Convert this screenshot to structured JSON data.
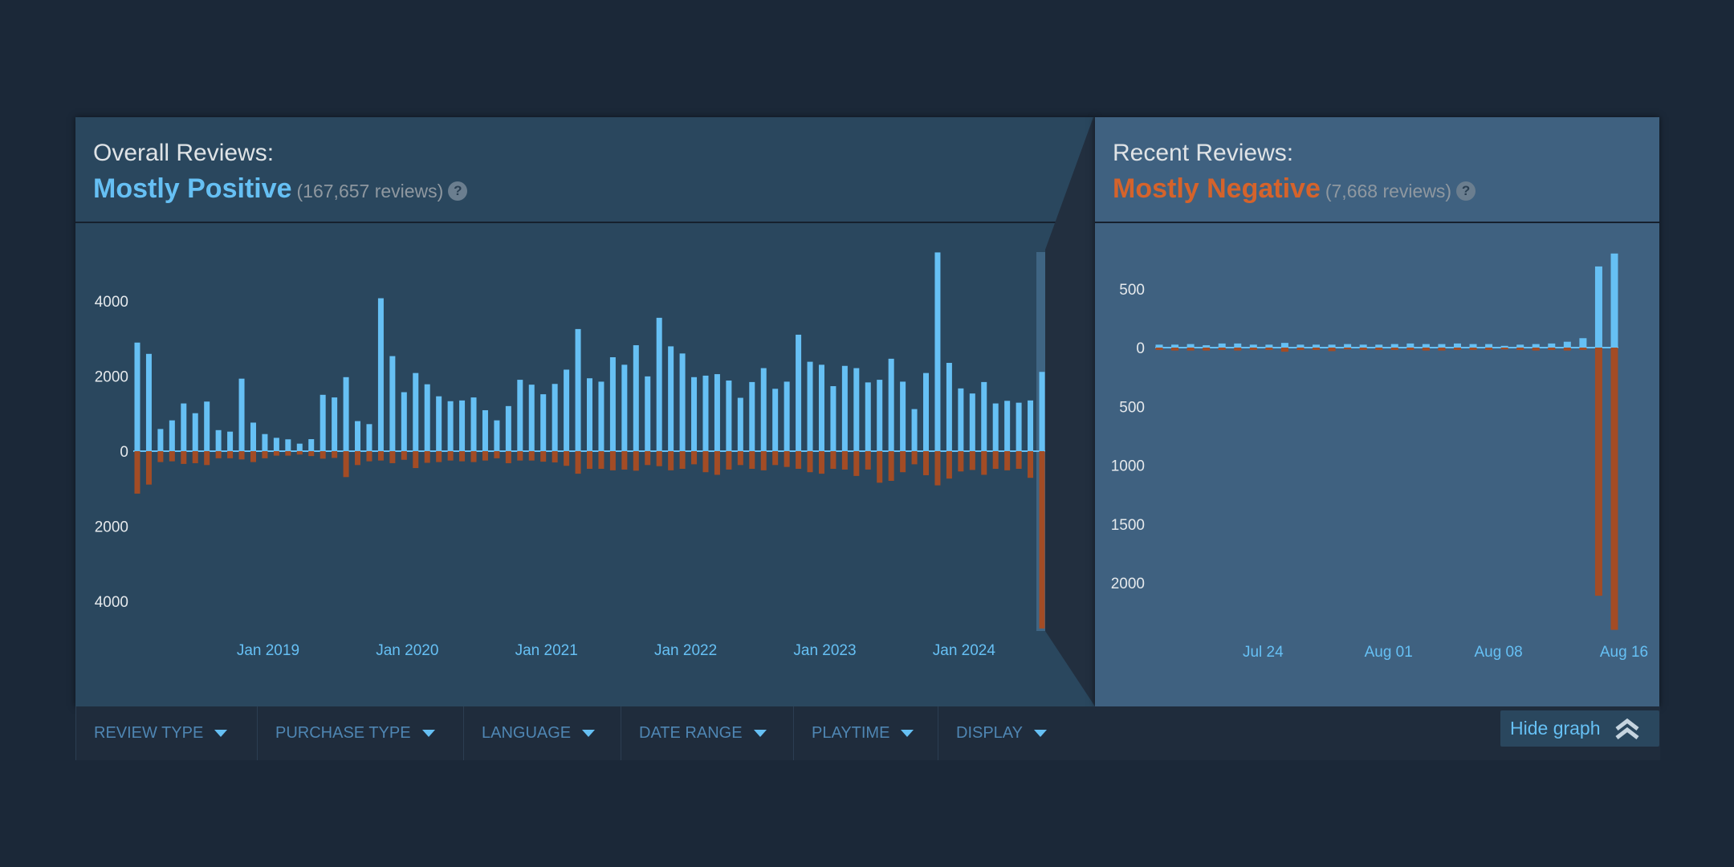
{
  "overall": {
    "title": "Overall Reviews:",
    "summary": "Mostly Positive",
    "count": "(167,657 reviews)",
    "help": "?",
    "color": "#66c0f4"
  },
  "recent": {
    "title": "Recent Reviews:",
    "summary": "Mostly Negative",
    "count": "(7,668 reviews)",
    "help": "?",
    "color": "#d5632b"
  },
  "filters": [
    {
      "label": "REVIEW TYPE"
    },
    {
      "label": "PURCHASE TYPE"
    },
    {
      "label": "LANGUAGE"
    },
    {
      "label": "DATE RANGE"
    },
    {
      "label": "PLAYTIME"
    },
    {
      "label": "DISPLAY"
    }
  ],
  "hide_graph": "Hide graph",
  "colors": {
    "positive": "#66c0f4",
    "negative": "#a34c25"
  },
  "chart_data": [
    {
      "type": "bar",
      "title": "",
      "xlabel": "",
      "ylabel": "",
      "period": "monthly, Feb 2018 - Aug 2024",
      "ylim": [
        -4800,
        5300
      ],
      "yticks": [
        {
          "v": 4000,
          "label": "4000"
        },
        {
          "v": 2000,
          "label": "2000"
        },
        {
          "v": 0,
          "label": "0"
        },
        {
          "v": -2000,
          "label": "2000"
        },
        {
          "v": -4000,
          "label": "4000"
        }
      ],
      "xticks": [
        {
          "i": 11,
          "label": "Jan 2019"
        },
        {
          "i": 23,
          "label": "Jan 2020"
        },
        {
          "i": 35,
          "label": "Jan 2021"
        },
        {
          "i": 47,
          "label": "Jan 2022"
        },
        {
          "i": 59,
          "label": "Jan 2023"
        },
        {
          "i": 71,
          "label": "Jan 2024"
        }
      ],
      "highlight_index": 78,
      "positive": [
        2890,
        2590,
        590,
        820,
        1270,
        1010,
        1320,
        560,
        520,
        1930,
        760,
        455,
        355,
        315,
        200,
        320,
        1500,
        1430,
        1970,
        800,
        720,
        4070,
        2530,
        1570,
        2080,
        1780,
        1460,
        1330,
        1350,
        1430,
        1090,
        820,
        1200,
        1900,
        1770,
        1515,
        1790,
        2170,
        3250,
        1940,
        1850,
        2500,
        2300,
        2820,
        1990,
        3550,
        2790,
        2600,
        1970,
        2010,
        2050,
        1880,
        1420,
        1840,
        2210,
        1660,
        1850,
        3100,
        2380,
        2300,
        1730,
        2270,
        2210,
        1830,
        1900,
        2460,
        1850,
        1120,
        2080,
        5290,
        2350,
        1670,
        1535,
        1840,
        1270,
        1340,
        1290,
        1350,
        2110
      ],
      "negative": [
        1130,
        890,
        290,
        270,
        340,
        320,
        370,
        190,
        190,
        220,
        290,
        190,
        120,
        120,
        90,
        130,
        200,
        180,
        690,
        370,
        270,
        250,
        320,
        230,
        450,
        310,
        290,
        250,
        270,
        290,
        250,
        190,
        320,
        250,
        250,
        280,
        300,
        390,
        600,
        470,
        470,
        510,
        490,
        520,
        370,
        400,
        510,
        470,
        350,
        560,
        630,
        490,
        370,
        470,
        510,
        370,
        420,
        470,
        560,
        600,
        470,
        490,
        660,
        490,
        840,
        790,
        560,
        350,
        640,
        910,
        730,
        540,
        500,
        630,
        470,
        510,
        470,
        710,
        4720
      ]
    },
    {
      "type": "bar",
      "title": "",
      "xlabel": "",
      "ylabel": "",
      "period": "daily, Jul 18 - Aug 16",
      "ylim": [
        -2450,
        850
      ],
      "yticks": [
        {
          "v": 500,
          "label": "500"
        },
        {
          "v": 0,
          "label": "0"
        },
        {
          "v": -500,
          "label": "500"
        },
        {
          "v": -1000,
          "label": "1000"
        },
        {
          "v": -1500,
          "label": "1500"
        },
        {
          "v": -2000,
          "label": "2000"
        }
      ],
      "xticks": [
        {
          "i": 6,
          "label": "Jul 24"
        },
        {
          "i": 14,
          "label": "Aug 01"
        },
        {
          "i": 21,
          "label": "Aug 08"
        },
        {
          "i": 29,
          "label": "Aug 16"
        }
      ],
      "positive": [
        25,
        25,
        30,
        20,
        35,
        35,
        25,
        25,
        40,
        25,
        25,
        25,
        30,
        25,
        25,
        30,
        35,
        30,
        30,
        35,
        30,
        30,
        15,
        25,
        30,
        35,
        50,
        80,
        690,
        800
      ],
      "negative": [
        20,
        25,
        25,
        25,
        20,
        25,
        20,
        20,
        35,
        20,
        20,
        30,
        15,
        20,
        20,
        20,
        20,
        25,
        25,
        20,
        20,
        20,
        15,
        20,
        25,
        20,
        25,
        20,
        2110,
        2400
      ]
    }
  ]
}
